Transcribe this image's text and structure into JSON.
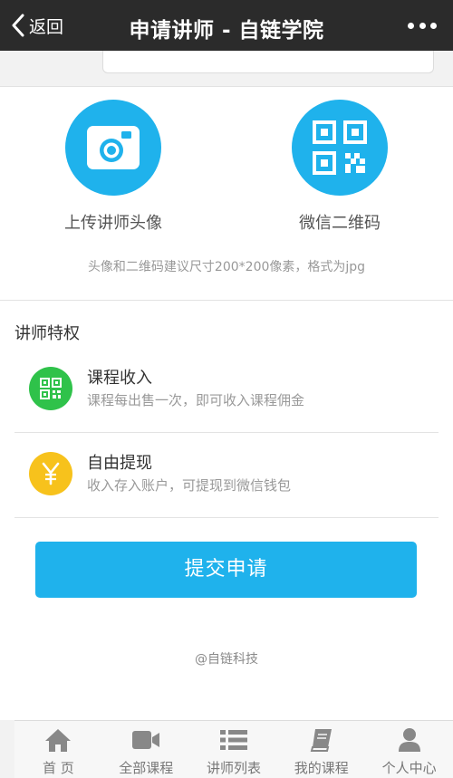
{
  "navbar": {
    "back_label": "返回",
    "title": "申请讲师 - 自链学院"
  },
  "uploads": {
    "avatar_label": "上传讲师头像",
    "qrcode_label": "微信二维码",
    "hint": "头像和二维码建议尺寸200*200像素，格式为jpg"
  },
  "perks": {
    "title": "讲师特权",
    "items": [
      {
        "name": "课程收入",
        "desc": "课程每出售一次，即可收入课程佣金",
        "icon": "qrcode-icon",
        "color": "#2fc24a"
      },
      {
        "name": "自由提现",
        "desc": "收入存入账户，可提现到微信钱包",
        "icon": "yen-icon",
        "color": "#f7c21c"
      }
    ]
  },
  "submit_label": "提交申请",
  "footer_brand": "@自链科技",
  "tabs": [
    {
      "label": "首 页",
      "icon": "home-icon"
    },
    {
      "label": "全部课程",
      "icon": "video-icon"
    },
    {
      "label": "讲师列表",
      "icon": "list-icon"
    },
    {
      "label": "我的课程",
      "icon": "book-icon"
    },
    {
      "label": "个人中心",
      "icon": "user-icon"
    }
  ],
  "colors": {
    "navbar_bg": "#2b2b2b",
    "accent_blue": "#1fb2ec",
    "perk_green": "#2fc24a",
    "perk_yellow": "#f7c21c"
  }
}
